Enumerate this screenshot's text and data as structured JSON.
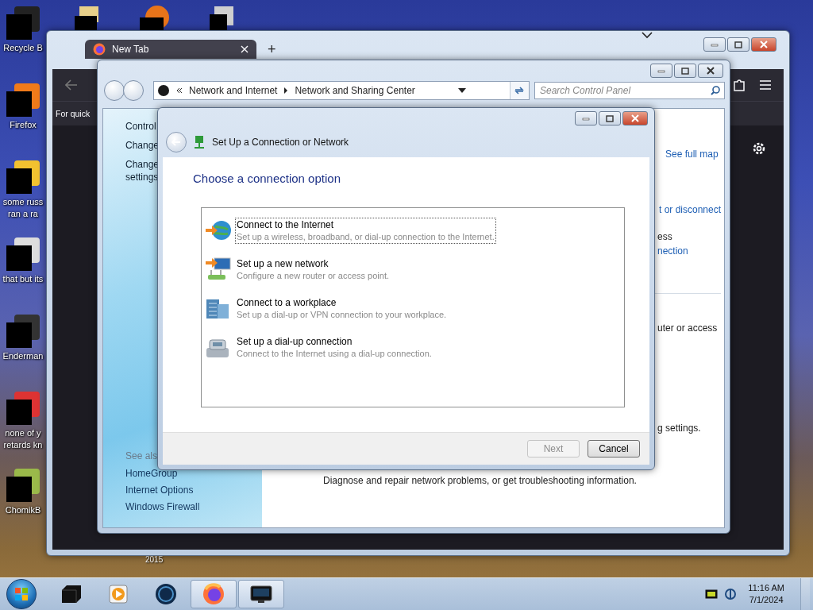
{
  "desktop_icons": [
    {
      "kind": "bin",
      "lines": [
        "Recycle B"
      ]
    },
    {
      "kind": "firefox",
      "lines": [
        "Firefox"
      ]
    },
    {
      "kind": "doc",
      "lines": [
        "some russ",
        "ran a ra"
      ]
    },
    {
      "kind": "stack",
      "lines": [
        "that but its"
      ]
    },
    {
      "kind": "console",
      "lines": [
        "Enderman"
      ]
    },
    {
      "kind": "chrome",
      "lines": [
        "none of y",
        "retards kn"
      ]
    },
    {
      "kind": "hamster",
      "lines": [
        "ChomikB"
      ]
    }
  ],
  "desktop_stray_label": "2015",
  "browser": {
    "tabs": [
      {
        "label": "New Tab",
        "selected": true
      }
    ],
    "new_tab": "+",
    "page_hint": "For quick"
  },
  "control_panel": {
    "breadcrumb": [
      "Network and Internet",
      "Network and Sharing Center"
    ],
    "search_placeholder": "Search Control Panel",
    "sidebar_top": [
      {
        "lines": [
          "Control"
        ]
      },
      {
        "lines": [
          "Change"
        ]
      },
      {
        "lines": [
          "Change",
          "settings"
        ]
      }
    ],
    "see_also_heading": "See als",
    "see_also": [
      "HomeGroup",
      "Internet Options",
      "Windows Firewall"
    ],
    "main_fragments": [
      {
        "kind": "link",
        "text": "See full map"
      },
      {
        "kind": "link",
        "text": "t or disconnect"
      },
      {
        "kind": "text",
        "text": "ess"
      },
      {
        "kind": "link",
        "text": "nection"
      },
      {
        "kind": "rule"
      },
      {
        "kind": "text",
        "text": "uter or access"
      },
      {
        "kind": "text",
        "text": "g settings."
      },
      {
        "kind": "text",
        "text": "Diagnose and repair network problems, or get troubleshooting information."
      }
    ]
  },
  "dialog": {
    "title": "Set Up a Connection or Network",
    "heading": "Choose a connection option",
    "options": [
      {
        "kind": "internet",
        "title": "Connect to the Internet",
        "description": "Set up a wireless, broadband, or dial-up connection to the Internet.",
        "selected": true
      },
      {
        "kind": "network",
        "title": "Set up a new network",
        "description": "Configure a new router or access point.",
        "selected": false
      },
      {
        "kind": "workplace",
        "title": "Connect to a workplace",
        "description": "Set up a dial-up or VPN connection to your workplace.",
        "selected": false
      },
      {
        "kind": "dialup",
        "title": "Set up a dial-up connection",
        "description": "Connect to the Internet using a dial-up connection.",
        "selected": false
      }
    ],
    "buttons": [
      {
        "label": "Next",
        "disabled": true
      },
      {
        "label": "Cancel",
        "disabled": false
      }
    ]
  },
  "taskbar": {
    "items": [
      {
        "kind": "terminal",
        "open": false
      },
      {
        "kind": "player",
        "open": false
      },
      {
        "kind": "globe",
        "open": false
      },
      {
        "kind": "firefox",
        "open": true
      },
      {
        "kind": "screen",
        "open": true
      }
    ],
    "time": "11:16 AM",
    "date": "7/1/2024"
  }
}
